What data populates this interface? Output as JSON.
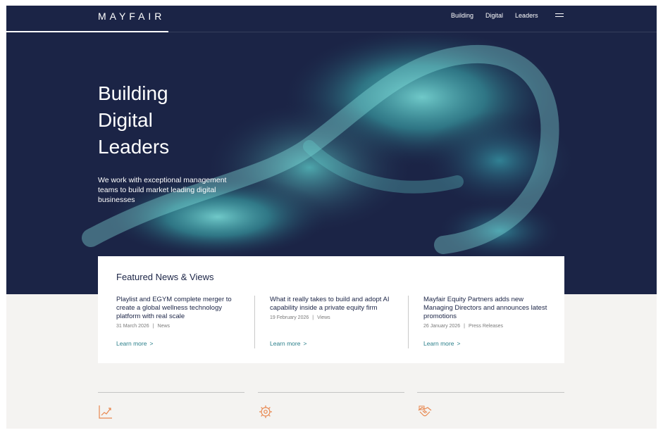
{
  "brand": {
    "logo": "MAYFAIR"
  },
  "nav": {
    "items": [
      {
        "label": "Building"
      },
      {
        "label": "Digital"
      },
      {
        "label": "Leaders"
      }
    ],
    "menu_icon": "hamburger-menu-icon"
  },
  "hero": {
    "headline_lines": [
      "Building",
      "Digital",
      "Leaders"
    ],
    "subcopy": "We work with exceptional management teams to build market leading digital businesses"
  },
  "news": {
    "title": "Featured News & Views",
    "learn_more_label": "Learn more",
    "items": [
      {
        "headline": "Playlist and EGYM complete merger to create a global wellness technology platform with real scale",
        "date": "31 March 2026",
        "category": "News"
      },
      {
        "headline": "What it really takes to build and adopt AI capability inside a private equity firm",
        "date": "19 February 2026",
        "category": "Views"
      },
      {
        "headline": "Mayfair Equity Partners adds new Managing Directors and announces latest promotions",
        "date": "26 January 2026",
        "category": "Press Releases"
      }
    ],
    "meta_separator": "|",
    "chevron": ">"
  },
  "features": {
    "icons": [
      "growth-chart-icon",
      "gear-brain-icon",
      "handshake-icon"
    ]
  },
  "colors": {
    "navy": "#1b2446",
    "teal_accent": "#2a7f8a",
    "orange_icon": "#e8874f",
    "page_bg": "#f4f3f1"
  }
}
